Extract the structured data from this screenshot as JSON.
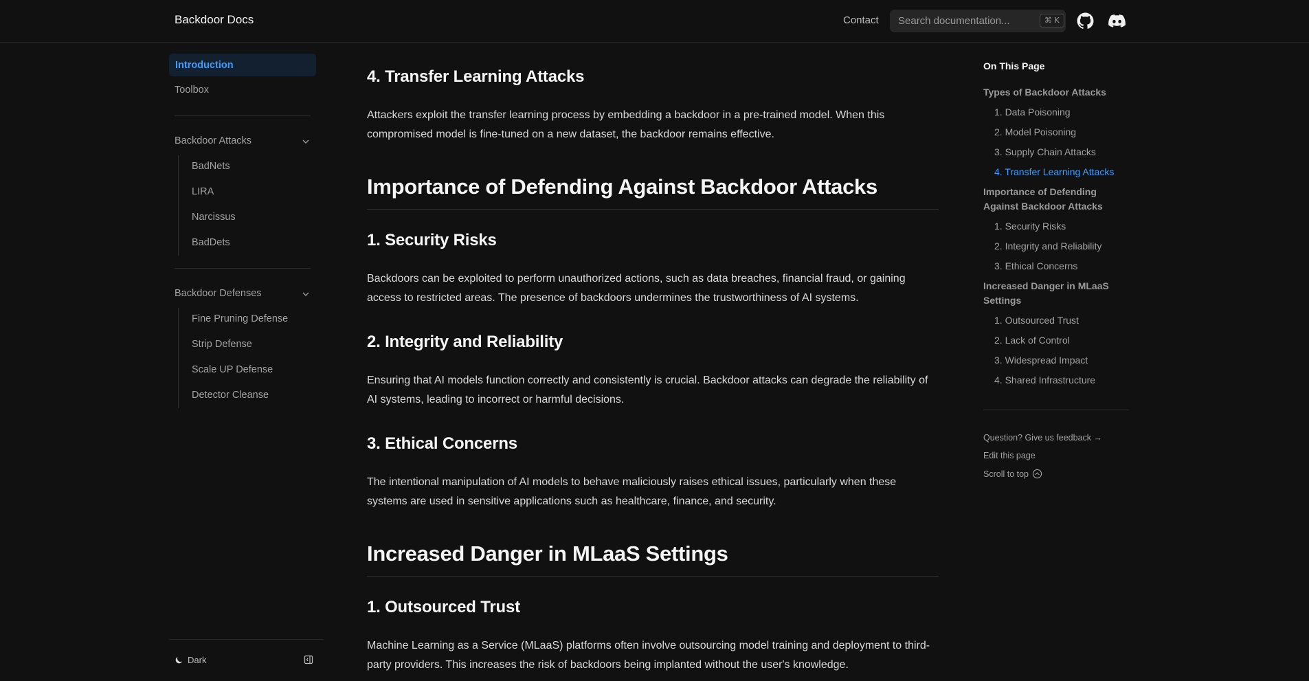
{
  "navbar": {
    "brand": "Backdoor Docs",
    "contact": "Contact",
    "search_placeholder": "Search documentation...",
    "search_shortcut": "⌘ K",
    "icons": [
      "github-icon",
      "discord-icon"
    ]
  },
  "sidebar": {
    "top_items": [
      "Introduction",
      "Toolbox"
    ],
    "groups": [
      {
        "label": "Backdoor Attacks",
        "items": [
          "BadNets",
          "LIRA",
          "Narcissus",
          "BadDets"
        ]
      },
      {
        "label": "Backdoor Defenses",
        "items": [
          "Fine Pruning Defense",
          "Strip Defense",
          "Scale UP Defense",
          "Detector Cleanse"
        ]
      }
    ],
    "theme_label": "Dark"
  },
  "content": {
    "sections": [
      {
        "heading": "4. Transfer Learning Attacks",
        "text": "Attackers exploit the transfer learning process by embedding a backdoor in a pre-trained model. When this compromised model is fine-tuned on a new dataset, the backdoor remains effective."
      },
      {
        "heading": "Importance of Defending Against Backdoor Attacks"
      },
      {
        "heading": "1. Security Risks",
        "text": "Backdoors can be exploited to perform unauthorized actions, such as data breaches, financial fraud, or gaining access to restricted areas. The presence of backdoors undermines the trustworthiness of AI systems."
      },
      {
        "heading": "2. Integrity and Reliability",
        "text": "Ensuring that AI models function correctly and consistently is crucial. Backdoor attacks can degrade the reliability of AI systems, leading to incorrect or harmful decisions."
      },
      {
        "heading": "3. Ethical Concerns",
        "text": "The intentional manipulation of AI models to behave maliciously raises ethical issues, particularly when these systems are used in sensitive applications such as healthcare, finance, and security."
      },
      {
        "heading": "Increased Danger in MLaaS Settings"
      },
      {
        "heading": "1. Outsourced Trust",
        "text": "Machine Learning as a Service (MLaaS) platforms often involve outsourcing model training and deployment to third-party providers. This increases the risk of backdoors being implanted without the user's knowledge."
      }
    ]
  },
  "toc": {
    "title": "On This Page",
    "items": [
      "Types of Backdoor Attacks",
      "1. Data Poisoning",
      "2. Model Poisoning",
      "3. Supply Chain Attacks",
      "4. Transfer Learning Attacks",
      "Importance of Defending Against Backdoor Attacks",
      "1. Security Risks",
      "2. Integrity and Reliability",
      "3. Ethical Concerns",
      "Increased Danger in MLaaS Settings",
      "1. Outsourced Trust",
      "2. Lack of Control",
      "3. Widespread Impact",
      "4. Shared Infrastructure"
    ],
    "active_item": "4. Transfer Learning Attacks",
    "feedback": "Question? Give us feedback →",
    "edit": "Edit this page",
    "scroll_top": "Scroll to top"
  },
  "colors": {
    "accent": "#3b9eff",
    "background": "#111111",
    "active_bg": "#132030"
  }
}
